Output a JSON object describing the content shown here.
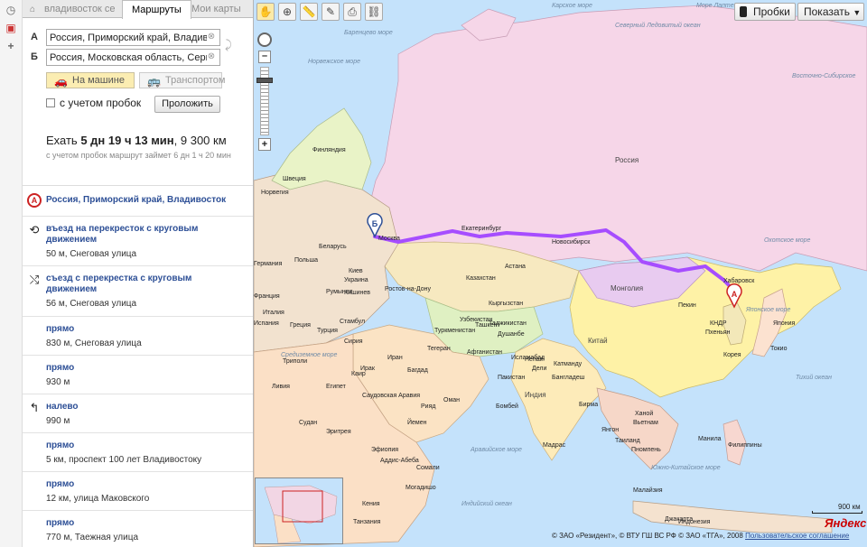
{
  "tabs": {
    "home_label": "владивосток се",
    "routes_label": "Маршруты",
    "maps_label": "Мои карты"
  },
  "route": {
    "from_letter": "А",
    "from_value": "Россия, Приморский край, Владивост",
    "to_letter": "Б",
    "to_value": "Россия, Московская область, Серпух",
    "mode_car": "На машине",
    "mode_transport": "Транспортом",
    "traffic_checkbox": "с учетом пробок",
    "route_button": "Проложить",
    "summary_prefix": "Ехать",
    "summary_time": "5 дн 19 ч 13 мин",
    "summary_distance": ", 9 300 км",
    "summary_sub": "с учетом пробок маршрут займет 6 дн 1 ч 20 мин"
  },
  "steps": [
    {
      "icon": "start-a-icon",
      "badge": "A",
      "action": "Россия, Приморский край, Владивосток"
    },
    {
      "icon": "roundabout-enter-icon",
      "action": "въезд на перекресток с круговым движением",
      "meta": "50 м, Снеговая улица"
    },
    {
      "icon": "roundabout-exit-icon",
      "action": "съезд с перекрестка с круговым движением",
      "meta": "56 м, Снеговая улица"
    },
    {
      "icon": "straight-icon",
      "action": "прямо",
      "meta": "830 м, Снеговая улица"
    },
    {
      "icon": "straight-icon",
      "action": "прямо",
      "meta": "930 м"
    },
    {
      "icon": "turn-left-icon",
      "action": "налево",
      "meta": "990 м"
    },
    {
      "icon": "straight-icon",
      "action": "прямо",
      "meta": "5 км, проспект 100 лет Владивостоку"
    },
    {
      "icon": "straight-icon",
      "action": "прямо",
      "meta": "12 км, улица Маковского"
    },
    {
      "icon": "straight-icon",
      "action": "прямо",
      "meta": "770 м, Таежная улица"
    }
  ],
  "map": {
    "traffic_button": "Пробки",
    "show_button": "Показать",
    "scale_label": "900 км",
    "brand": "Яндекс",
    "copyright_text": "© ЗАО «Резидент», © ВТУ ГШ ВС РФ © ЗАО «ТГА», 2008",
    "copyright_link": "Пользовательское соглашение",
    "route_color": "#a64dff",
    "marker_start": "A",
    "marker_end": "Б",
    "labels": {
      "seas": [
        "Карское море",
        "Море Лаптевых",
        "Восточно-Сибирское",
        "Норвежское море",
        "Баренцево море",
        "Охотское море",
        "Японское море",
        "Аравийское море",
        "Южно-Китайское море",
        "Индийский океан",
        "Тихий океан",
        "Средиземное море",
        "Северный Ледовитый океан"
      ],
      "countries": [
        "Россия",
        "Монголия",
        "Китай",
        "Казахстан",
        "Финляндия",
        "Швеция",
        "Норвегия",
        "Беларусь",
        "Украина",
        "Германия",
        "Франция",
        "Польша",
        "Туркменистан",
        "Узбекистан",
        "Афганистан",
        "Пакистан",
        "Индия",
        "Иран",
        "Ирак",
        "Турция",
        "Египет",
        "Ливия",
        "Судан",
        "Эфиопия",
        "Йемен",
        "Оман",
        "Корея",
        "Япония",
        "Вьетнам",
        "Таиланд",
        "Филиппины",
        "Индонезия",
        "Малайзия",
        "Бирма",
        "Бангладеш",
        "Саудовская Аравия",
        "Эритрея",
        "Непал",
        "Италия",
        "Испания",
        "Румыния",
        "Греция",
        "Сирия",
        "Кения",
        "Сомали",
        "Танзания",
        "Кыргызстан",
        "Таджикистан",
        "КНДР"
      ],
      "cities": [
        "Москва",
        "Екатеринбург",
        "Новосибирск",
        "Хабаровск",
        "Астана",
        "Ташкент",
        "Душанбе",
        "Исламабад",
        "Тегеран",
        "Киев",
        "Кишинев",
        "Ростов-на-Дону",
        "Стамбул",
        "Каир",
        "Триполи",
        "Пекин",
        "Пхеньян",
        "Токио",
        "Ханой",
        "Янгон",
        "Пномпень",
        "Манила",
        "Аддис-Абеба",
        "Могадишо",
        "Джакарта",
        "Мадрас",
        "Бомбей",
        "Дели",
        "Катманду",
        "Багдад",
        "Рияд"
      ]
    }
  }
}
